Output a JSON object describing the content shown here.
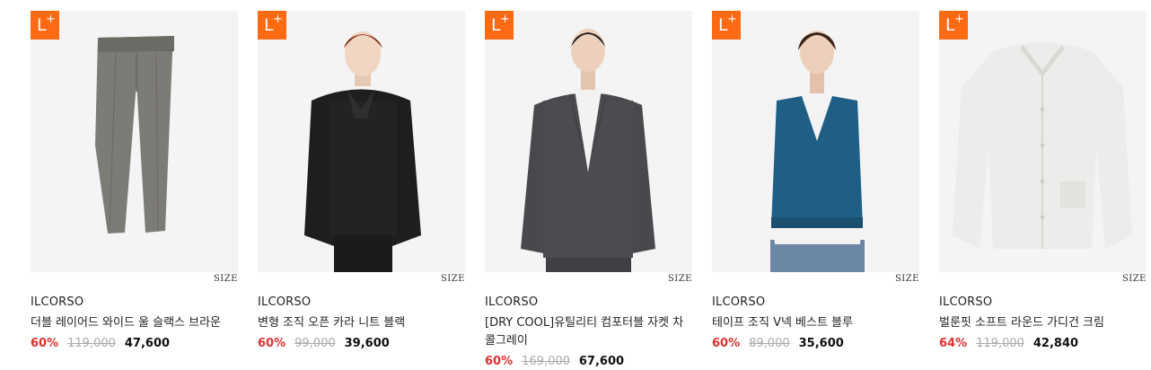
{
  "products": [
    {
      "badge": "L",
      "brand": "ILCORSO",
      "name": "더블 레이어드 와이드 울 슬랙스 브라운",
      "discount": "60%",
      "original_price": "119,000",
      "sale_price": "47,600",
      "size_label": "SIZE",
      "image": "gray-wide-slacks"
    },
    {
      "badge": "L",
      "brand": "ILCORSO",
      "name": "변형 조직 오픈 카라 니트 블랙",
      "discount": "60%",
      "original_price": "99,000",
      "sale_price": "39,600",
      "size_label": "SIZE",
      "image": "model-black-collar-knit"
    },
    {
      "badge": "L",
      "brand": "ILCORSO",
      "name": "[DRY COOL]유틸리티 컴포터블 자켓 차콜그레이",
      "discount": "60%",
      "original_price": "169,000",
      "sale_price": "67,600",
      "size_label": "SIZE",
      "image": "model-charcoal-jacket"
    },
    {
      "badge": "L",
      "brand": "ILCORSO",
      "name": "테이프 조직 V넥 베스트 블루",
      "discount": "60%",
      "original_price": "89,000",
      "sale_price": "35,600",
      "size_label": "SIZE",
      "image": "model-blue-knit-vest"
    },
    {
      "badge": "L",
      "brand": "ILCORSO",
      "name": "벌룬핏 소프트 라운드 가디건 크림",
      "discount": "64%",
      "original_price": "119,000",
      "sale_price": "42,840",
      "size_label": "SIZE",
      "image": "cream-cardigan"
    }
  ],
  "colors": {
    "badge": "#ff6a13",
    "discount": "#e03131",
    "strike": "#aaaaaa"
  }
}
